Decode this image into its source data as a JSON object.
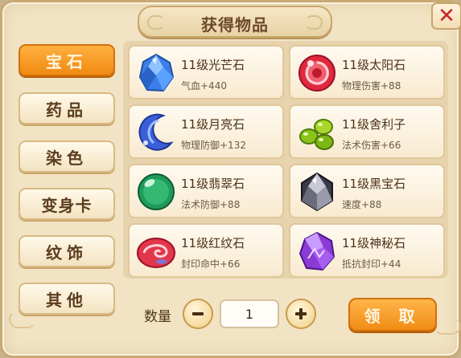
{
  "dialog": {
    "title": "获得物品",
    "close_symbol": "✕"
  },
  "tabs": [
    {
      "label": "宝石",
      "active": true
    },
    {
      "label": "药品",
      "active": false
    },
    {
      "label": "染色",
      "active": false
    },
    {
      "label": "变身卡",
      "active": false
    },
    {
      "label": "纹饰",
      "active": false
    },
    {
      "label": "其他",
      "active": false
    }
  ],
  "items": [
    {
      "name": "11级光芒石",
      "stat": "气血+440",
      "icon": "blue-crystal-icon"
    },
    {
      "name": "11级太阳石",
      "stat": "物理伤害+88",
      "icon": "red-sun-stone-icon"
    },
    {
      "name": "11级月亮石",
      "stat": "物理防御+132",
      "icon": "blue-moon-icon"
    },
    {
      "name": "11级舍利子",
      "stat": "法术伤害+66",
      "icon": "green-beads-icon"
    },
    {
      "name": "11级翡翠石",
      "stat": "法术防御+88",
      "icon": "green-jade-orb-icon"
    },
    {
      "name": "11级黑宝石",
      "stat": "速度+88",
      "icon": "black-diamond-icon"
    },
    {
      "name": "11级红纹石",
      "stat": "封印命中+66",
      "icon": "red-swirl-stone-icon"
    },
    {
      "name": "11级神秘石",
      "stat": "抵抗封印+44",
      "icon": "purple-mystic-stone-icon"
    }
  ],
  "quantity": {
    "label": "数量",
    "value": "1"
  },
  "claim_label": "领 取",
  "colors": {
    "accent_orange": "#f08a12",
    "panel_bg": "#f1e3c3",
    "close_red": "#c9212a"
  }
}
